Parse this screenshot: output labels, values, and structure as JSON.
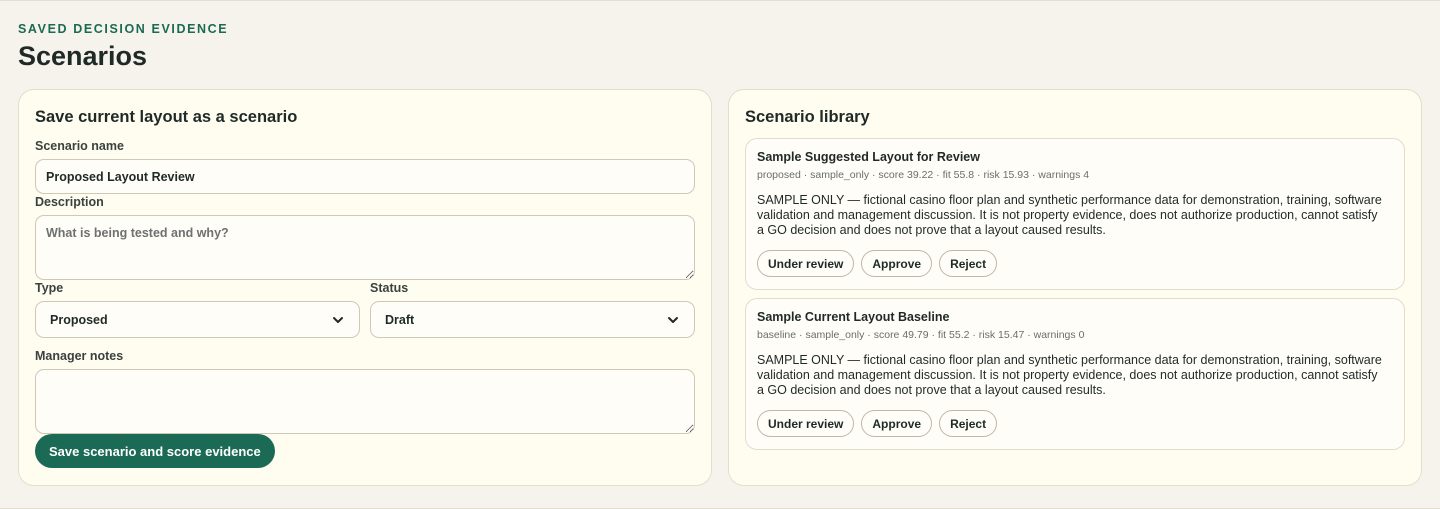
{
  "header": {
    "eyebrow": "SAVED DECISION EVIDENCE",
    "title": "Scenarios"
  },
  "form": {
    "title": "Save current layout as a scenario",
    "scenario_name_label": "Scenario name",
    "scenario_name_value": "Proposed Layout Review",
    "description_label": "Description",
    "description_placeholder": "What is being tested and why?",
    "type_label": "Type",
    "type_value": "Proposed",
    "status_label": "Status",
    "status_value": "Draft",
    "notes_label": "Manager notes",
    "save_label": "Save scenario and score evidence"
  },
  "library": {
    "title": "Scenario library",
    "items": [
      {
        "name": "Sample Suggested Layout for Review",
        "meta": "proposed · sample_only · score 39.22 · fit 55.8 · risk 15.93 · warnings 4",
        "description": "SAMPLE ONLY — fictional casino floor plan and synthetic performance data for demonstration, training, software validation and management discussion. It is not property evidence, does not authorize production, cannot satisfy a GO decision and does not prove that a layout caused results.",
        "actions": [
          "Under review",
          "Approve",
          "Reject"
        ]
      },
      {
        "name": "Sample Current Layout Baseline",
        "meta": "baseline · sample_only · score 49.79 · fit 55.2 · risk 15.47 · warnings 0",
        "description": "SAMPLE ONLY — fictional casino floor plan and synthetic performance data for demonstration, training, software validation and management discussion. It is not property evidence, does not authorize production, cannot satisfy a GO decision and does not prove that a layout caused results.",
        "actions": [
          "Under review",
          "Approve",
          "Reject"
        ]
      }
    ]
  },
  "colors": {
    "accent": "#1b6a55",
    "background": "#f6f3ec",
    "card": "#fffcf0"
  }
}
